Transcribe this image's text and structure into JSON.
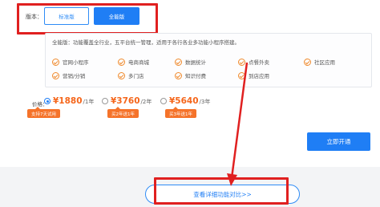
{
  "edition": {
    "label": "版本：",
    "standard": "标准版",
    "full": "全能版"
  },
  "features": {
    "description": "全能版：功能覆盖全行业，五平台统一管理，适用于各行各业多功能小程序搭建。",
    "items": [
      "官网小程序",
      "电商商城",
      "数据统计",
      "点餐外卖",
      "社区应用",
      "营销/分销",
      "多门店",
      "知识付费",
      "到店应用"
    ]
  },
  "pricing": {
    "label": "价格：",
    "options": [
      {
        "amount": "¥1880",
        "period": "/1年",
        "badge": "支持7天试用",
        "selected": true
      },
      {
        "amount": "¥3760",
        "period": "/2年",
        "badge": "买2年送1年",
        "selected": false
      },
      {
        "amount": "¥5640",
        "period": "/3年",
        "badge": "买3年送1年",
        "selected": false
      }
    ]
  },
  "actions": {
    "activate": "立即开通",
    "compare": "查看详细功能对比>>"
  },
  "colors": {
    "accent": "#1f7ef5",
    "price": "#f5661b",
    "badge": "#f5732a",
    "highlight": "#e02020"
  }
}
